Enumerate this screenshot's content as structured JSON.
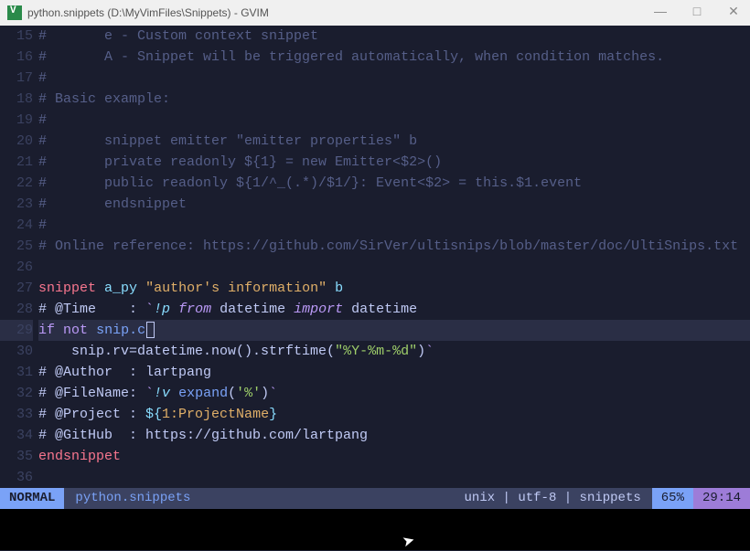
{
  "titlebar": {
    "title": "python.snippets (D:\\MyVimFiles\\Snippets) - GVIM",
    "minimize": "—",
    "maximize": "□",
    "close": "✕"
  },
  "gutter": {
    "start": 15,
    "end": 36
  },
  "code": {
    "l15": {
      "comment": "#       e - Custom context snippet"
    },
    "l16": {
      "comment": "#       A - Snippet will be triggered automatically, when condition matches."
    },
    "l17": {
      "comment": "#"
    },
    "l18": {
      "comment": "# Basic example:"
    },
    "l19": {
      "comment": "#"
    },
    "l20": {
      "comment": "#       snippet emitter \"emitter properties\" b"
    },
    "l21": {
      "comment": "#       private readonly ${1} = new Emitter<$2>()"
    },
    "l22": {
      "comment": "#       public readonly ${1/^_(.*)/$1/}: Event<$2> = this.$1.event"
    },
    "l23": {
      "comment": "#       endsnippet"
    },
    "l24": {
      "comment": "#"
    },
    "l25": {
      "comment": "# Online reference: https://github.com/SirVer/ultisnips/blob/master/doc/UltiSnips.txt"
    },
    "l27": {
      "kw": "snippet",
      "name": "a_py",
      "desc": "\"author's information\"",
      "flag": "b"
    },
    "l28": {
      "comment": "# @Time    : ",
      "backtick1": "`",
      "excl": "!p",
      "from": "from",
      "mod": "datetime",
      "imp": "import",
      "obj": "datetime"
    },
    "l29": {
      "if": "if",
      "not": "not",
      "rest": "snip.c"
    },
    "l30": {
      "indent": "    ",
      "text1": "snip.rv=datetime.now().strftime(",
      "str": "\"%Y-%m-%d\"",
      "text2": ")",
      "backtick": "`"
    },
    "l31": {
      "comment": "# @Author  : lartpang"
    },
    "l32": {
      "comment": "# @FileName: ",
      "backtick1": "`",
      "excl": "!v",
      "fn": "expand",
      "paren1": "(",
      "arg": "'%'",
      "paren2": ")",
      "backtick2": "`"
    },
    "l33": {
      "comment": "# @Project : ",
      "brace1": "${",
      "ph": "1:ProjectName",
      "brace2": "}"
    },
    "l34": {
      "comment": "# @GitHub  : https://github.com/lartpang"
    },
    "l35": {
      "kw": "endsnippet"
    }
  },
  "statusline": {
    "mode": "NORMAL",
    "file": "python.snippets",
    "info": "unix | utf-8 | snippets",
    "pct": "65%",
    "pos": "29:14"
  }
}
